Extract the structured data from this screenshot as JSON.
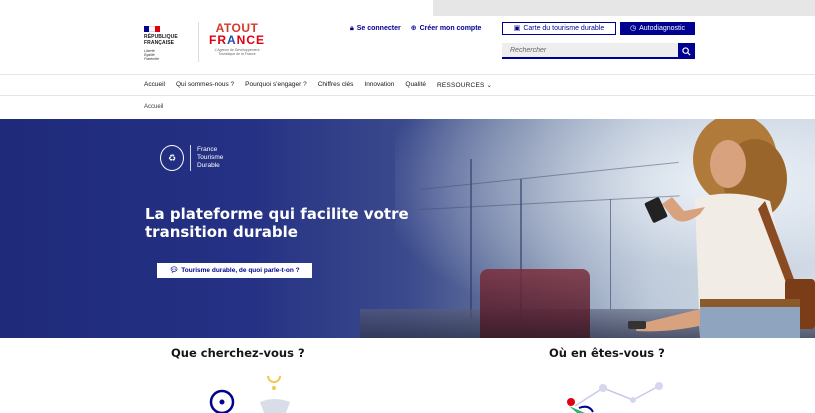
{
  "header": {
    "republique": [
      "RÉPUBLIQUE",
      "FRANÇAISE"
    ],
    "motto": [
      "Liberté",
      "Égalité",
      "Fraternité"
    ],
    "flag_colors": [
      "#000091",
      "#ffffff",
      "#e1000f"
    ],
    "atout": {
      "line1": "ATOUT",
      "line2_left": "FR",
      "line2_a": "A",
      "line2_right": "NCE",
      "tagline": "L'Agence de Développement Touristique de la France"
    },
    "links": {
      "login": {
        "icon": "lock-icon",
        "label": "Se connecter"
      },
      "signup": {
        "icon": "user-plus-icon",
        "label": "Créer mon compte"
      }
    },
    "map_button": {
      "icon": "map-icon",
      "label": "Carte du tourisme durable"
    },
    "diag_button": {
      "icon": "clock-icon",
      "label": "Autodiagnostic"
    },
    "search": {
      "placeholder": "Rechercher",
      "icon": "search-icon"
    }
  },
  "nav": {
    "items": [
      "Accueil",
      "Qui sommes-nous ?",
      "Pourquoi s'engager ?",
      "Chiffres clés",
      "Innovation",
      "Qualité",
      "RESSOURCES"
    ],
    "dropdown_icon": "chevron-down-icon"
  },
  "breadcrumb": "Accueil",
  "hero": {
    "badge_lines": [
      "France",
      "Tourisme",
      "Durable"
    ],
    "title": "La plateforme qui facilite votre transition durable",
    "cta": {
      "icon": "chat-icon",
      "label": "Tourisme durable, de quoi parle-t-on ?"
    }
  },
  "sections": {
    "left_title": "Que cherchez-vous ?",
    "right_title": "Où en êtes-vous ?"
  },
  "colors": {
    "brand_blue": "#000091",
    "brand_red": "#e1000f"
  }
}
